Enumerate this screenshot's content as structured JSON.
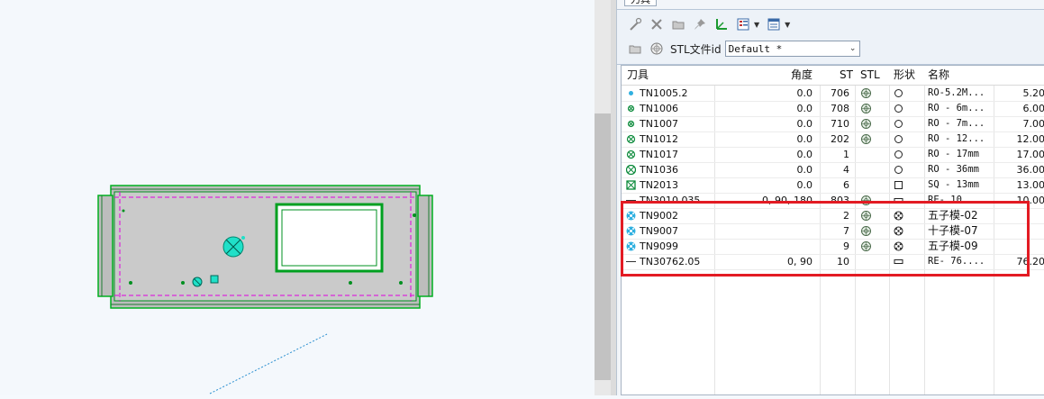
{
  "panel": {
    "tab_title": "刀具",
    "stl_label": "STL文件id",
    "stl_combo_value": "Default *"
  },
  "toolbar_icons": [
    "wand-icon",
    "delete-icon",
    "folder-icon",
    "pin-icon",
    "axis-icon",
    "list-view-icon",
    "details-view-icon"
  ],
  "table": {
    "headers": {
      "tool": "刀具",
      "angle": "角度",
      "st": "ST",
      "stl": "STL",
      "shape": "形状",
      "name": "名称"
    },
    "rows": [
      {
        "tool": "TN1005.2",
        "angle": "0.0",
        "st": "706",
        "name": "RO-5.2M...",
        "extra": "5.20",
        "icon": "tiny-dot",
        "stl": true,
        "shape": "circle"
      },
      {
        "tool": "TN1006",
        "angle": "0.0",
        "st": "708",
        "name": "RO - 6m...",
        "extra": "6.00",
        "icon": "small-x-circle",
        "stl": true,
        "shape": "circle"
      },
      {
        "tool": "TN1007",
        "angle": "0.0",
        "st": "710",
        "name": "RO - 7m...",
        "extra": "7.00",
        "icon": "small-x-circle",
        "stl": true,
        "shape": "circle"
      },
      {
        "tool": "TN1012",
        "angle": "0.0",
        "st": "202",
        "name": "RO - 12...",
        "extra": "12.00",
        "icon": "x-circle",
        "stl": true,
        "shape": "circle"
      },
      {
        "tool": "TN1017",
        "angle": "0.0",
        "st": "1",
        "name": "RO - 17mm",
        "extra": "17.00",
        "icon": "x-circle",
        "stl": false,
        "shape": "circle"
      },
      {
        "tool": "TN1036",
        "angle": "0.0",
        "st": "4",
        "name": "RO - 36mm",
        "extra": "36.00",
        "icon": "big-x-circle",
        "stl": false,
        "shape": "circle"
      },
      {
        "tool": "TN2013",
        "angle": "0.0",
        "st": "6",
        "name": "SQ - 13mm",
        "extra": "13.00",
        "icon": "x-square",
        "stl": false,
        "shape": "square"
      },
      {
        "tool": "TN3010.035",
        "angle": "0, 90, 180",
        "st": "803",
        "name": "RE- 10...",
        "extra": "10.00",
        "icon": "dash",
        "stl": true,
        "shape": "rect"
      },
      {
        "tool": "TN9002",
        "angle": "",
        "st": "2",
        "name": "五子模-02",
        "extra": "",
        "icon": "cluster",
        "stl": true,
        "shape": "cluster"
      },
      {
        "tool": "TN9007",
        "angle": "",
        "st": "7",
        "name": "十子模-07",
        "extra": "",
        "icon": "cluster",
        "stl": true,
        "shape": "cluster"
      },
      {
        "tool": "TN9099",
        "angle": "",
        "st": "9",
        "name": "五子模-09",
        "extra": "",
        "icon": "cluster",
        "stl": true,
        "shape": "cluster"
      },
      {
        "tool": "TN30762.05",
        "angle": "0, 90",
        "st": "10",
        "name": "RE- 76....",
        "extra": "76.20",
        "icon": "dash",
        "stl": false,
        "shape": "rect"
      }
    ]
  },
  "colors": {
    "highlight": "#e31b23",
    "part_fill": "#c8c8c8",
    "part_edge": "#00c020",
    "construction": "#e000e0",
    "feature": "#00d8c0"
  }
}
